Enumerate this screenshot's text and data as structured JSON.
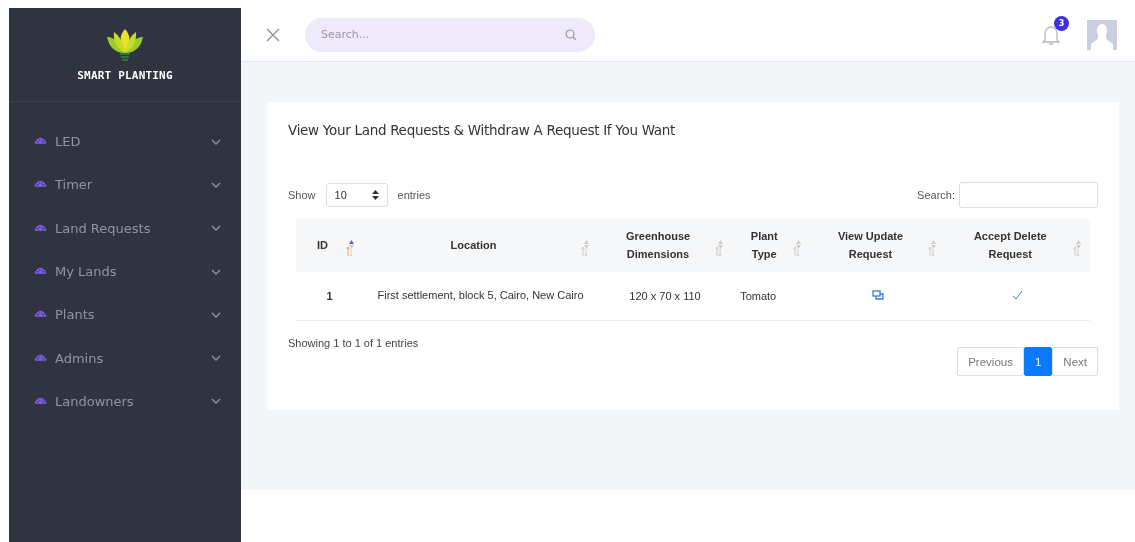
{
  "brand": {
    "name": "SMART PLANTING"
  },
  "sidebar": {
    "items": [
      {
        "label": "LED"
      },
      {
        "label": "Timer"
      },
      {
        "label": "Land Requests"
      },
      {
        "label": "My Lands"
      },
      {
        "label": "Plants"
      },
      {
        "label": "Admins"
      },
      {
        "label": "Landowners"
      }
    ]
  },
  "header": {
    "search": {
      "placeholder": "Search..."
    },
    "notifications": {
      "count": "3"
    }
  },
  "card": {
    "title": "View Your Land Requests & Withdraw A Request If You Want",
    "length": {
      "before": "Show",
      "value": "10",
      "after": "entries"
    },
    "filter": {
      "label": "Search:"
    },
    "table": {
      "columns": [
        {
          "label": "ID",
          "sorted": true
        },
        {
          "label": "Location",
          "sorted": false
        },
        {
          "label": "Greenhouse Dimensions",
          "sorted": false
        },
        {
          "label": "Plant Type",
          "sorted": false
        },
        {
          "label": "View Update Request",
          "sorted": false
        },
        {
          "label": "Accept Delete Request",
          "sorted": false
        }
      ],
      "rows": [
        {
          "id": "1",
          "location": "First settlement, block 5, Cairo, New Cairo",
          "dimensions": "120 x 70 x 110",
          "plant_type": "Tomato",
          "accepted": true
        }
      ]
    },
    "info": "Showing 1 to 1 of 1 entries",
    "pagination": {
      "previous": "Previous",
      "pages": [
        {
          "label": "1",
          "selected": true
        }
      ],
      "next": "Next"
    }
  }
}
